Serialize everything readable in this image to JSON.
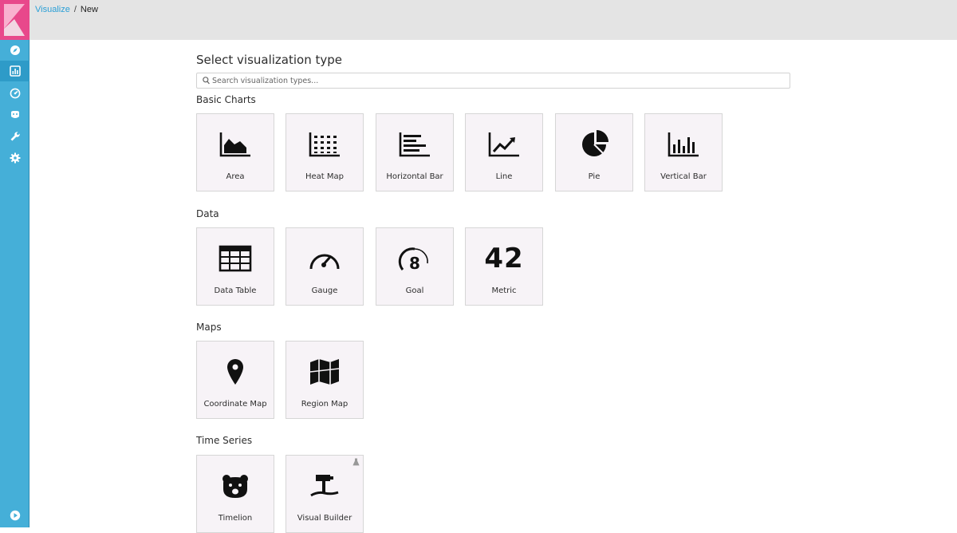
{
  "breadcrumb": {
    "link": "Visualize",
    "separator": "/",
    "current": "New"
  },
  "title": "Select visualization type",
  "search": {
    "placeholder": "Search visualization types...",
    "value": ""
  },
  "nav": {
    "items": [
      {
        "icon": "compass-icon",
        "name": "discover"
      },
      {
        "icon": "bar-chart-icon",
        "name": "visualize",
        "active": true
      },
      {
        "icon": "dashboard-icon",
        "name": "dashboard"
      },
      {
        "icon": "timelion-icon",
        "name": "timelion"
      },
      {
        "icon": "wrench-icon",
        "name": "dev-tools"
      },
      {
        "icon": "gear-icon",
        "name": "management"
      },
      {
        "icon": "play-icon",
        "name": "collapse"
      }
    ]
  },
  "sections": {
    "basic": {
      "title": "Basic Charts",
      "tiles": [
        {
          "label": "Area",
          "icon": "area-chart-icon"
        },
        {
          "label": "Heat Map",
          "icon": "heat-map-icon"
        },
        {
          "label": "Horizontal Bar",
          "icon": "horizontal-bar-icon"
        },
        {
          "label": "Line",
          "icon": "line-chart-icon"
        },
        {
          "label": "Pie",
          "icon": "pie-chart-icon"
        },
        {
          "label": "Vertical Bar",
          "icon": "vertical-bar-icon"
        }
      ]
    },
    "data": {
      "title": "Data",
      "tiles": [
        {
          "label": "Data Table",
          "icon": "table-icon"
        },
        {
          "label": "Gauge",
          "icon": "gauge-icon"
        },
        {
          "label": "Goal",
          "icon": "goal-icon",
          "glyph": "8"
        },
        {
          "label": "Metric",
          "icon": "metric-icon",
          "glyph": "42"
        }
      ]
    },
    "maps": {
      "title": "Maps",
      "tiles": [
        {
          "label": "Coordinate Map",
          "icon": "map-marker-icon"
        },
        {
          "label": "Region Map",
          "icon": "region-map-icon"
        }
      ]
    },
    "timeseries": {
      "title": "Time Series",
      "tiles": [
        {
          "label": "Timelion",
          "icon": "timelion-bear-icon"
        },
        {
          "label": "Visual Builder",
          "icon": "visual-builder-icon",
          "badge": "experimental-flask-icon"
        }
      ]
    }
  },
  "colors": {
    "sidebar": "#45afd8",
    "logo": "#e8488b",
    "link": "#2a9fd6",
    "topbar": "#e4e4e4",
    "tile_bg": "#f7f3f7"
  }
}
